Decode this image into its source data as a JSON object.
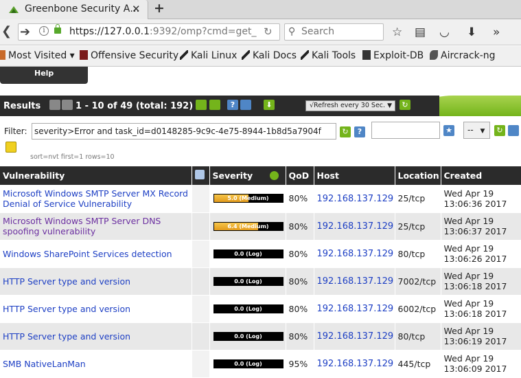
{
  "browser": {
    "tab_title": "Greenbone Security A…",
    "url_host": "https://127.0.0.1",
    "url_rest": ":9392/omp?cmd=get_",
    "search_placeholder": "Search"
  },
  "bookmarks": [
    "Most Visited ▾",
    "Offensive Security",
    "Kali Linux",
    "Kali Docs",
    "Kali Tools",
    "Exploit-DB",
    "Aircrack-ng"
  ],
  "help_label": "Help",
  "results": {
    "title": "Results",
    "range": "1 - 10 of 49 (total: 192)",
    "refresh_option": "√Refresh every 30 Sec."
  },
  "filter": {
    "label": "Filter:",
    "value": "severity>Error and task_id=d0148285-9c9c-4e75-8944-1b8d5a7904f",
    "select_value": "--",
    "sort_text": "sort=nvt first=1 rows=10"
  },
  "columns": {
    "vulnerability": "Vulnerability",
    "severity": "Severity",
    "qod": "QoD",
    "host": "Host",
    "location": "Location",
    "created": "Created"
  },
  "colors": {
    "severity_medium": "#e29a1b",
    "header_bg": "#2b2b2b",
    "accent_green": "#74b41b"
  },
  "rows": [
    {
      "name": "Microsoft Windows SMTP Server MX Record Denial of Service Vulnerability",
      "visited": false,
      "severity_label": "5.0 (Medium)",
      "severity_fill": 0.5,
      "qod": "80%",
      "host": "192.168.137.129",
      "location": "25/tcp",
      "created_date": "Wed Apr 19",
      "created_time": "13:06:36 2017"
    },
    {
      "name": "Microsoft Windows SMTP Server DNS spoofing vulnerability",
      "visited": true,
      "severity_label": "6.4 (Medium)",
      "severity_fill": 0.64,
      "qod": "80%",
      "host": "192.168.137.129",
      "location": "25/tcp",
      "created_date": "Wed Apr 19",
      "created_time": "13:06:37 2017"
    },
    {
      "name": "Windows SharePoint Services detection",
      "visited": false,
      "severity_label": "0.0 (Log)",
      "severity_fill": 0,
      "qod": "80%",
      "host": "192.168.137.129",
      "location": "80/tcp",
      "created_date": "Wed Apr 19",
      "created_time": "13:06:26 2017"
    },
    {
      "name": "HTTP Server type and version",
      "visited": false,
      "severity_label": "0.0 (Log)",
      "severity_fill": 0,
      "qod": "80%",
      "host": "192.168.137.129",
      "location": "7002/tcp",
      "created_date": "Wed Apr 19",
      "created_time": "13:06:18 2017"
    },
    {
      "name": "HTTP Server type and version",
      "visited": false,
      "severity_label": "0.0 (Log)",
      "severity_fill": 0,
      "qod": "80%",
      "host": "192.168.137.129",
      "location": "6002/tcp",
      "created_date": "Wed Apr 19",
      "created_time": "13:06:18 2017"
    },
    {
      "name": "HTTP Server type and version",
      "visited": false,
      "severity_label": "0.0 (Log)",
      "severity_fill": 0,
      "qod": "80%",
      "host": "192.168.137.129",
      "location": "80/tcp",
      "created_date": "Wed Apr 19",
      "created_time": "13:06:19 2017"
    },
    {
      "name": "SMB NativeLanMan",
      "visited": false,
      "severity_label": "0.0 (Log)",
      "severity_fill": 0,
      "qod": "95%",
      "host": "192.168.137.129",
      "location": "445/tcp",
      "created_date": "Wed Apr 19",
      "created_time": "13:06:09 2017"
    }
  ]
}
